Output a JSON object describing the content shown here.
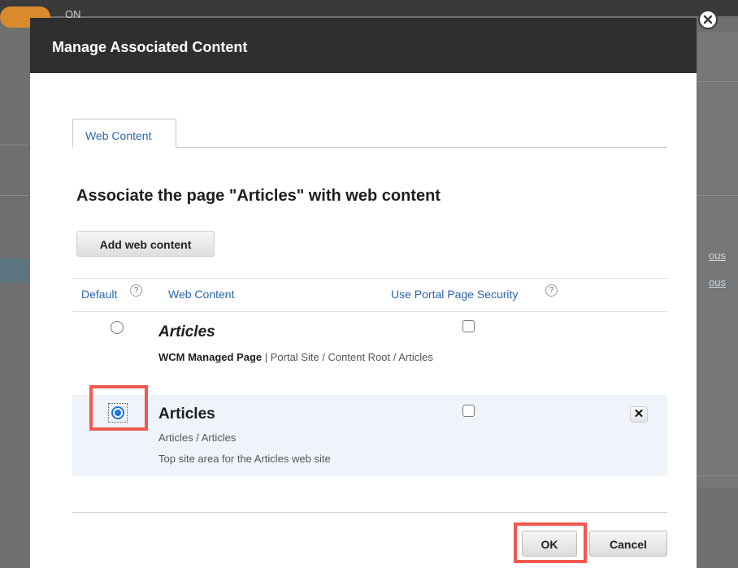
{
  "background": {
    "toggle_label": "ON",
    "right_links": [
      "ous",
      "ous"
    ]
  },
  "dialog": {
    "title": "Manage Associated Content",
    "close_icon": "close-circle-icon",
    "tabs": [
      {
        "label": "Web Content",
        "selected": true
      }
    ],
    "heading": "Associate the page \"Articles\" with web content",
    "add_button_label": "Add web content",
    "columns": {
      "default": "Default",
      "web_content": "Web Content",
      "portal_security": "Use Portal Page Security"
    },
    "help_icon_glyph": "?",
    "rows": [
      {
        "title": "Articles",
        "meta_type": "WCM Managed Page",
        "meta_separator": " | ",
        "meta_path": "Portal Site / Content Root / Articles",
        "default_selected": false,
        "portal_security_checked": false
      },
      {
        "title": "Articles",
        "path": "Articles / Articles",
        "description": "Top site area for the Articles web site",
        "default_selected": true,
        "portal_security_checked": false,
        "remove_glyph": "✕"
      }
    ],
    "ok_label": "OK",
    "cancel_label": "Cancel"
  },
  "colors": {
    "header": "#2f2f2f",
    "link": "#2a66a9",
    "highlight": "#f0584f",
    "selected_row": "#eff4fa",
    "radio_selected": "#1f73e8"
  }
}
